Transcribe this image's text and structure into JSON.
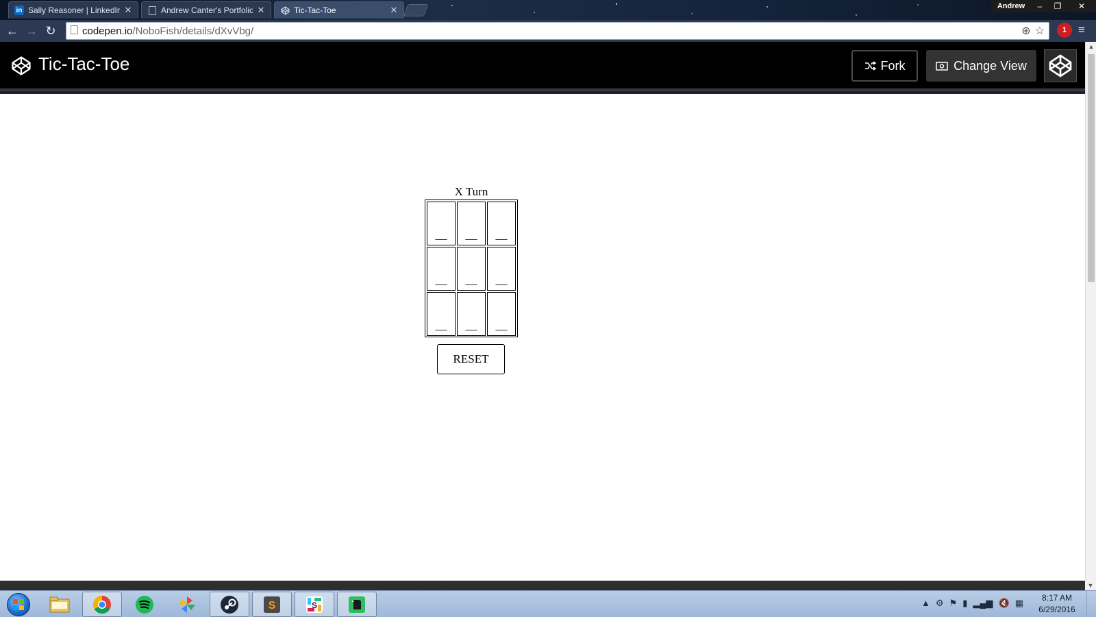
{
  "browser": {
    "tabs": [
      {
        "label": "Sally Reasoner | LinkedIn",
        "favicon": "linkedin-icon",
        "active": false
      },
      {
        "label": "Andrew Canter's Portfolio",
        "favicon": "page-icon",
        "active": false
      },
      {
        "label": "Tic-Tac-Toe",
        "favicon": "codepen-icon",
        "active": true
      }
    ],
    "user": "Andrew",
    "window_controls": {
      "minimize": "–",
      "restore": "❐",
      "close": "✕"
    },
    "address": {
      "host": "codepen.io",
      "path": "/NoboFish/details/dXvVbg/"
    },
    "extension_badge": "1"
  },
  "codepen": {
    "title": "Tic-Tac-Toe",
    "fork_label": "Fork",
    "change_view_label": "Change View"
  },
  "game": {
    "turn_text": "X Turn",
    "cells": [
      "__",
      "__",
      "__",
      "__",
      "__",
      "__",
      "__",
      "__",
      "__"
    ],
    "reset_label": "RESET"
  },
  "taskbar": {
    "apps": [
      "start-orb",
      "file-explorer-icon",
      "chrome-icon",
      "spotify-icon",
      "pinwheel-app-icon",
      "steam-icon",
      "sublime-text-icon",
      "slack-icon",
      "evernote-icon"
    ],
    "clock": {
      "time": "8:17 AM",
      "date": "6/29/2016"
    }
  },
  "colors": {
    "header_bg": "#000000",
    "change_view_bg": "#333333",
    "page_bg": "#ffffff",
    "taskbar_bg": "#a9c0dd"
  }
}
